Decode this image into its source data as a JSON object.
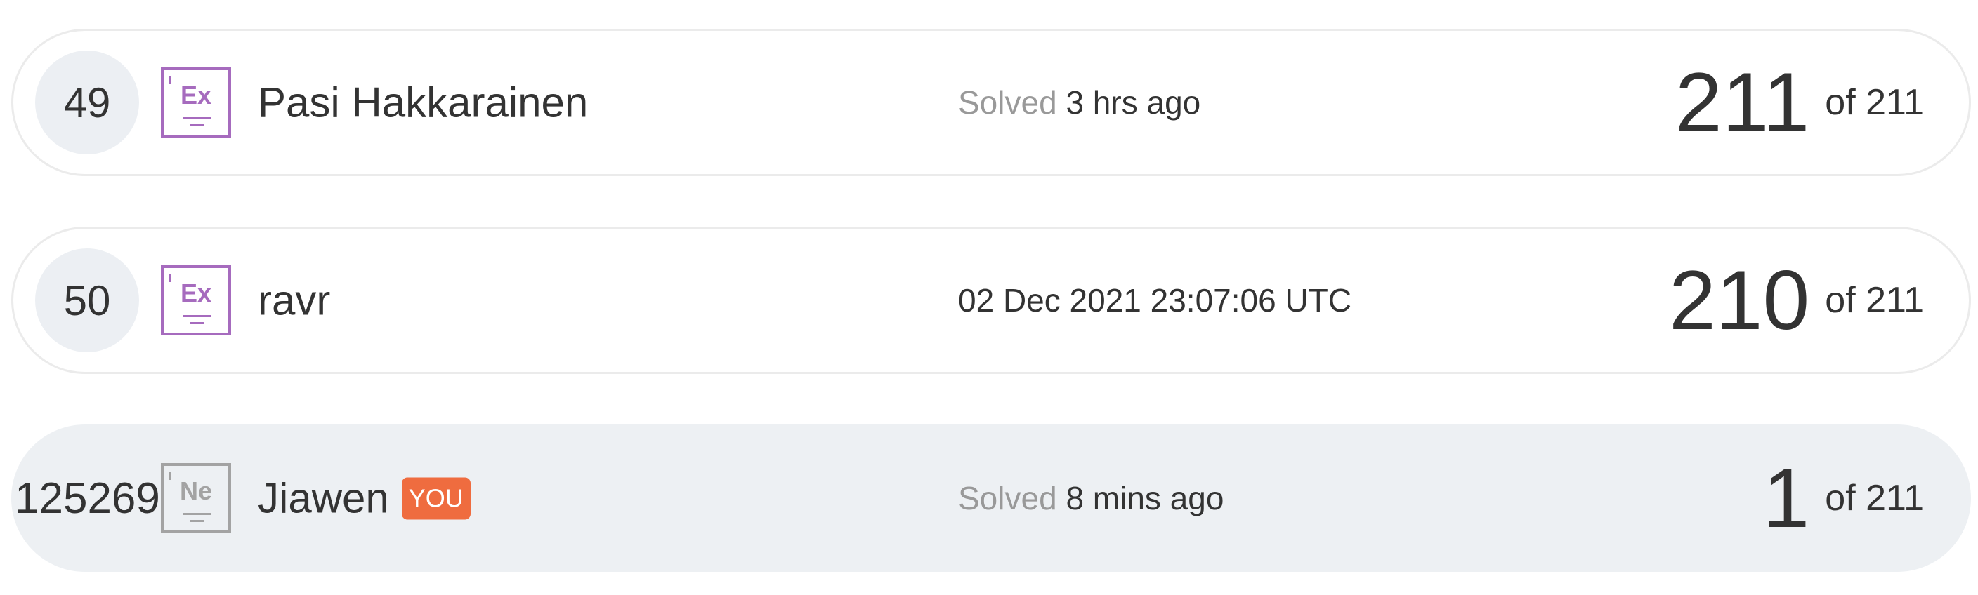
{
  "leaderboard": {
    "rows": [
      {
        "rank": "49",
        "level_abbr": "Ex",
        "level_icon": "expert-level-icon",
        "name": "Pasi Hakkarainen",
        "status_prefix": "Solved",
        "status_text": "3 hrs ago",
        "score": "211",
        "score_of": "of 211"
      },
      {
        "rank": "50",
        "level_abbr": "Ex",
        "level_icon": "expert-level-icon",
        "name": "ravr",
        "status_prefix": "",
        "status_text": "02 Dec 2021 23:07:06 UTC",
        "score": "210",
        "score_of": "of 211"
      },
      {
        "rank": "125269",
        "level_abbr": "Ne",
        "level_icon": "newbie-level-icon",
        "name": "Jiawen",
        "badge": "YOU",
        "status_prefix": "Solved",
        "status_text": "8 mins ago",
        "score": "1",
        "score_of": "of 211"
      }
    ]
  },
  "colors": {
    "expert_purple": "#a66bbe",
    "newbie_gray": "#a3a3a3",
    "you_badge": "#ef6c3f",
    "current_user_row": "#edf0f3",
    "muted_text": "#999999"
  }
}
